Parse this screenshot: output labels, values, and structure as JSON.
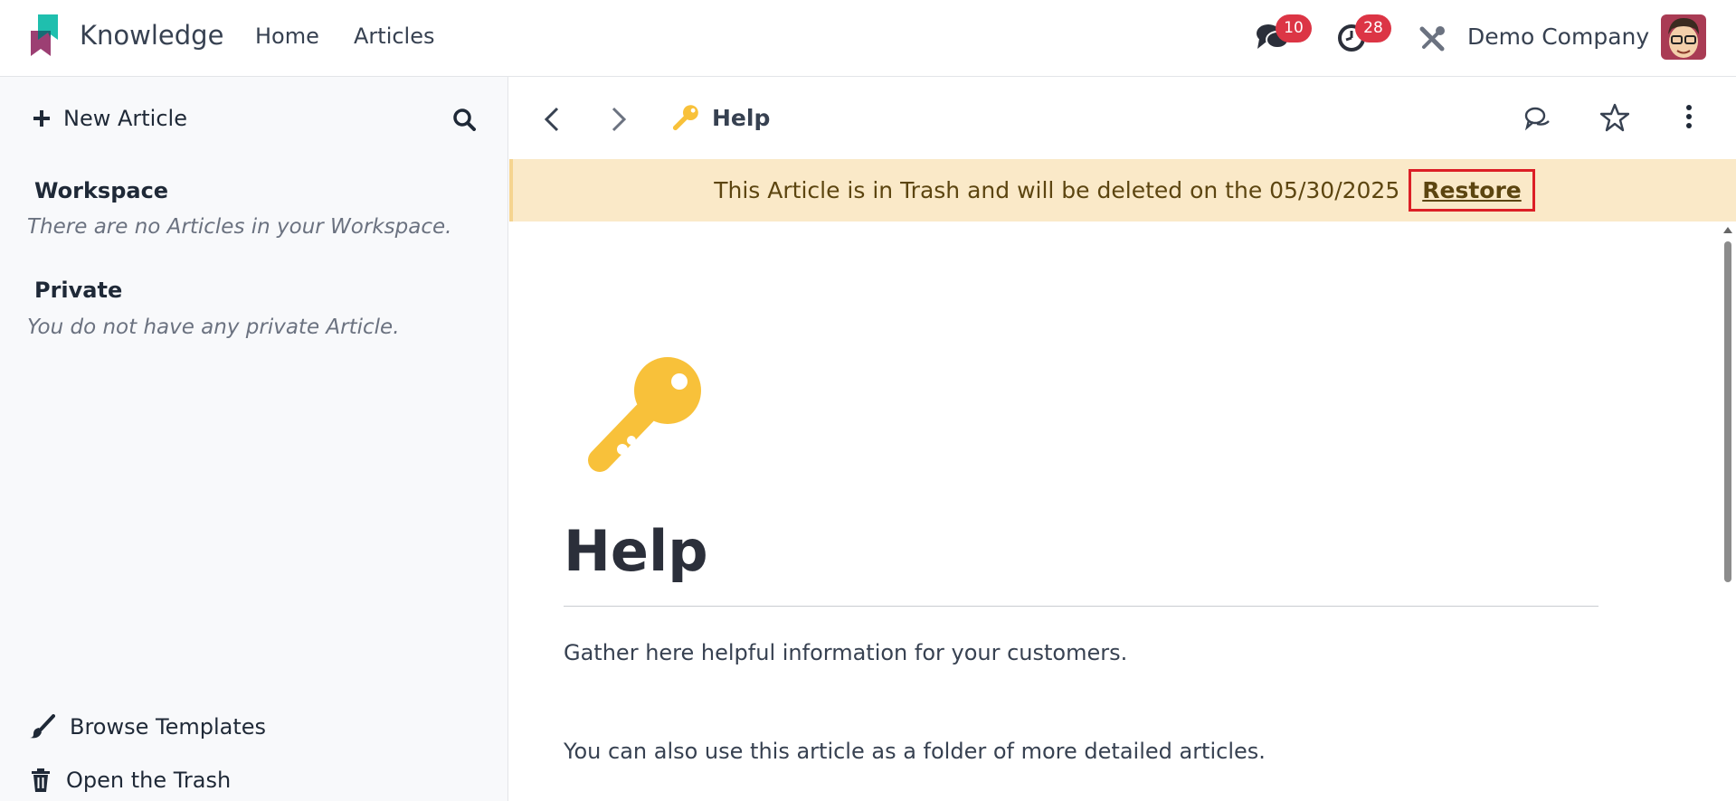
{
  "navbar": {
    "app_title": "Knowledge",
    "menu": [
      "Home",
      "Articles"
    ],
    "messages_badge": "10",
    "activities_badge": "28",
    "company": "Demo Company"
  },
  "sidebar": {
    "new_article_label": "New Article",
    "workspace": {
      "title": "Workspace",
      "empty": "There are no Articles in your Workspace."
    },
    "private": {
      "title": "Private",
      "empty": "You do not have any private Article."
    },
    "browse_templates": "Browse Templates",
    "open_trash": "Open the Trash"
  },
  "article": {
    "breadcrumb": "Help",
    "icon": "key-icon",
    "trash_notice": "This Article is in Trash and will be deleted on the 05/30/2025",
    "restore_label": "Restore",
    "title": "Help",
    "paragraphs": [
      "Gather here helpful information for your customers.",
      "You can also use this article as a folder of more detailed articles."
    ]
  },
  "colors": {
    "accent_key": "#f8c13a",
    "badge": "#dc3545",
    "banner": "#fae9c8",
    "highlight": "#dc1f26"
  }
}
